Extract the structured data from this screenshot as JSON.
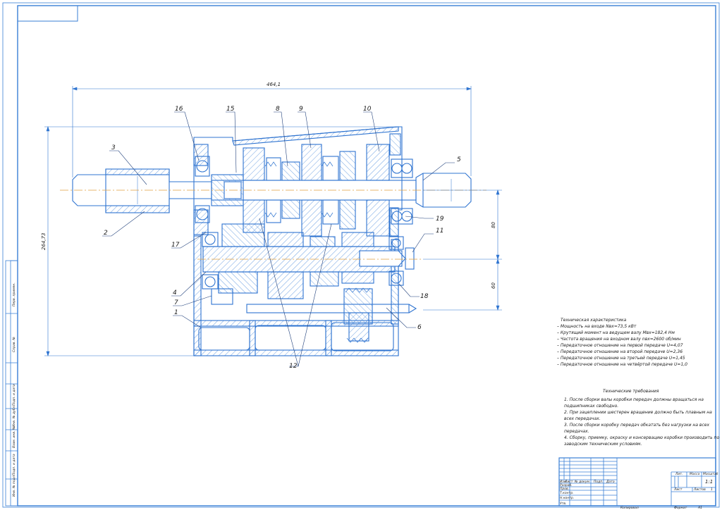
{
  "dimensions": {
    "overall_length": "464,1",
    "overall_height": "264,73",
    "center_distance_upper": "80",
    "center_distance_lower": "60"
  },
  "callouts": [
    "16",
    "15",
    "8",
    "9",
    "10",
    "3",
    "5",
    "2",
    "19",
    "11",
    "17",
    "4",
    "7",
    "1",
    "18",
    "6",
    "12"
  ],
  "tech_characteristics": {
    "title": "Техническая характеристика",
    "lines": [
      "– Мощность на входе Nвх=73,5 кВт",
      "– Крутящий момент на ведущем валу Mвх=182,4 Нм",
      "– Частота вращения на входном валу nвх=2600 об/мин",
      "– Передаточное отношение на первой передаче U=4,07",
      "– Передаточное отношение на второй передаче U=2,36",
      "– Передаточное отношение на третьей передаче U=1,45",
      "– Передаточное отношение на четвёртой передаче U=1,0"
    ]
  },
  "tech_requirements": {
    "title": "Технические требования",
    "lines": [
      "1. После сборки валы коробки передач должны вращаться на",
      "подшипниках свободно.",
      "2. При зацеплении шестерен вращение должно быть плавным на",
      "всех передачах.",
      "3. После сборки коробку передач обкатать без нагрузки на всех",
      "передачах.",
      "4. Сборку, приемку, окраску и консервацию коробки производить по",
      "заводским техническим условиям."
    ]
  },
  "title_block": {
    "col_headers": [
      "Изм",
      "Лист",
      "№ докум.",
      "Подп.",
      "Дата"
    ],
    "row_labels": [
      "Разраб.",
      "Пров.",
      "Т.контр.",
      "Н.контр.",
      "Утв."
    ],
    "lit_label": "Лит.",
    "mass_label": "Масса",
    "scale_label": "Масштаб",
    "scale_value": "1:1",
    "sheet_label": "Лист",
    "sheets_label": "Листов",
    "sheets_value": "1",
    "copied_label": "Копировал",
    "format_label": "Формат",
    "format_value": "А1"
  },
  "side_stamp": [
    "Инв. № подл.",
    "Подп. и дата",
    "Взам. инв. №",
    "Инв. № дубл.",
    "Подп. и дата",
    "Справ. №",
    "Перв. примен."
  ],
  "colors": {
    "frame": "#3a7fd6",
    "drawing": "#2f74d0",
    "hatch": "#4c8bdc",
    "axis": "#e0a040",
    "text": "#1a1a1a"
  }
}
